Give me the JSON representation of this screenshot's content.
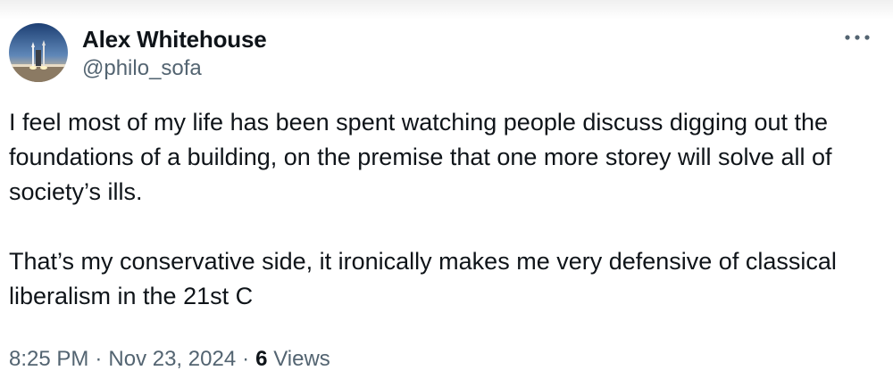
{
  "author": {
    "display_name": "Alex Whitehouse",
    "handle": "@philo_sofa",
    "avatar_icon": "rocket-launch-avatar"
  },
  "more_icon": "more-options-icon",
  "tweet": {
    "paragraphs": [
      "I feel most of my life has been spent watching people discuss digging out the foundations of a building, on the premise that one more storey will solve all of society’s ills.",
      "That’s my conservative side, it ironically makes me very defensive of classical liberalism in the 21st C"
    ]
  },
  "meta": {
    "time": "8:25 PM",
    "separator": "·",
    "date": "Nov 23, 2024",
    "views_count": "6",
    "views_label": "Views"
  },
  "colors": {
    "text_primary": "#0f1419",
    "text_secondary": "#536471",
    "background": "#ffffff"
  }
}
